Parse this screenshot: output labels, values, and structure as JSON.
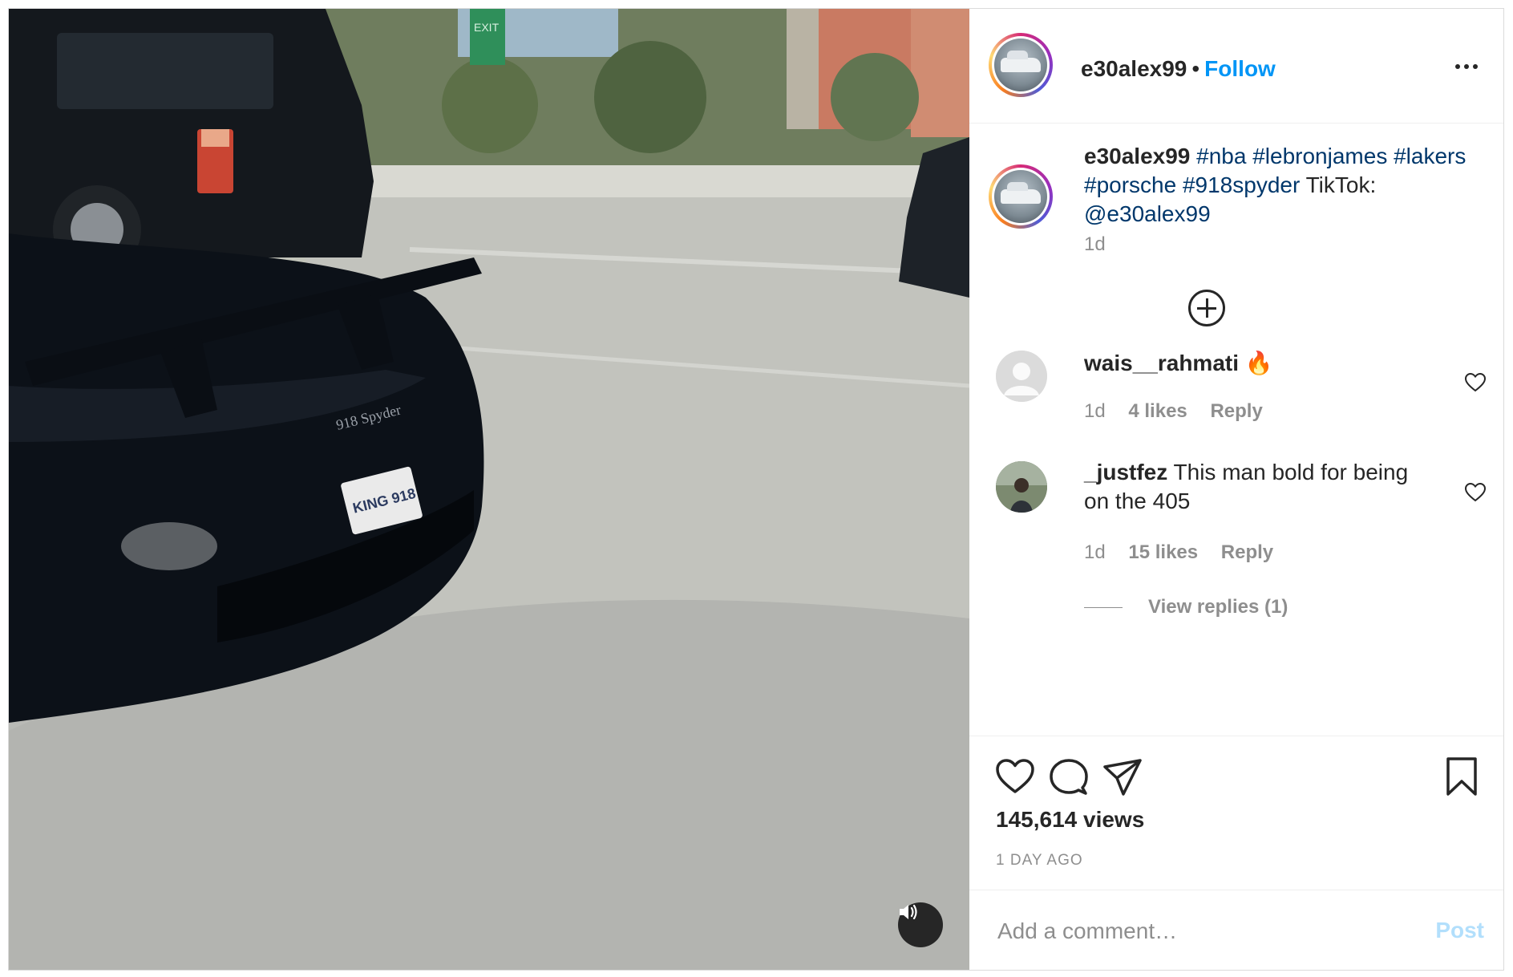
{
  "post": {
    "author": "e30alex99",
    "follow_separator": "•",
    "follow_label": "Follow",
    "caption": {
      "username": "e30alex99",
      "hashtags": [
        "#nba",
        "#lebronjames",
        "#lakers",
        "#porsche",
        "#918spyder"
      ],
      "text_after": "TikTok:",
      "mention": "@e30alex99",
      "time": "1d"
    },
    "media": {
      "sign_text": "EXIT",
      "plate_text": "KING 918",
      "badge_text": "918 Spyder"
    },
    "comments": [
      {
        "username": "wais__rahmati",
        "text": "🔥",
        "time": "1d",
        "likes": "4 likes",
        "reply": "Reply"
      },
      {
        "username": "_justfez",
        "text": "This man bold for being on the 405",
        "time": "1d",
        "likes": "15 likes",
        "reply": "Reply",
        "view_replies": "View replies (1)"
      }
    ],
    "views": "145,614 views",
    "posted": "1 DAY AGO",
    "add_comment_placeholder": "Add a comment…",
    "post_button": "Post"
  },
  "colors": {
    "link": "#00376b",
    "follow": "#0095f6",
    "post_button": "#b2dffc"
  },
  "icons": [
    "more-icon",
    "plus-circle-icon",
    "heart-icon",
    "comment-icon",
    "share-icon",
    "bookmark-icon",
    "volume-icon"
  ]
}
